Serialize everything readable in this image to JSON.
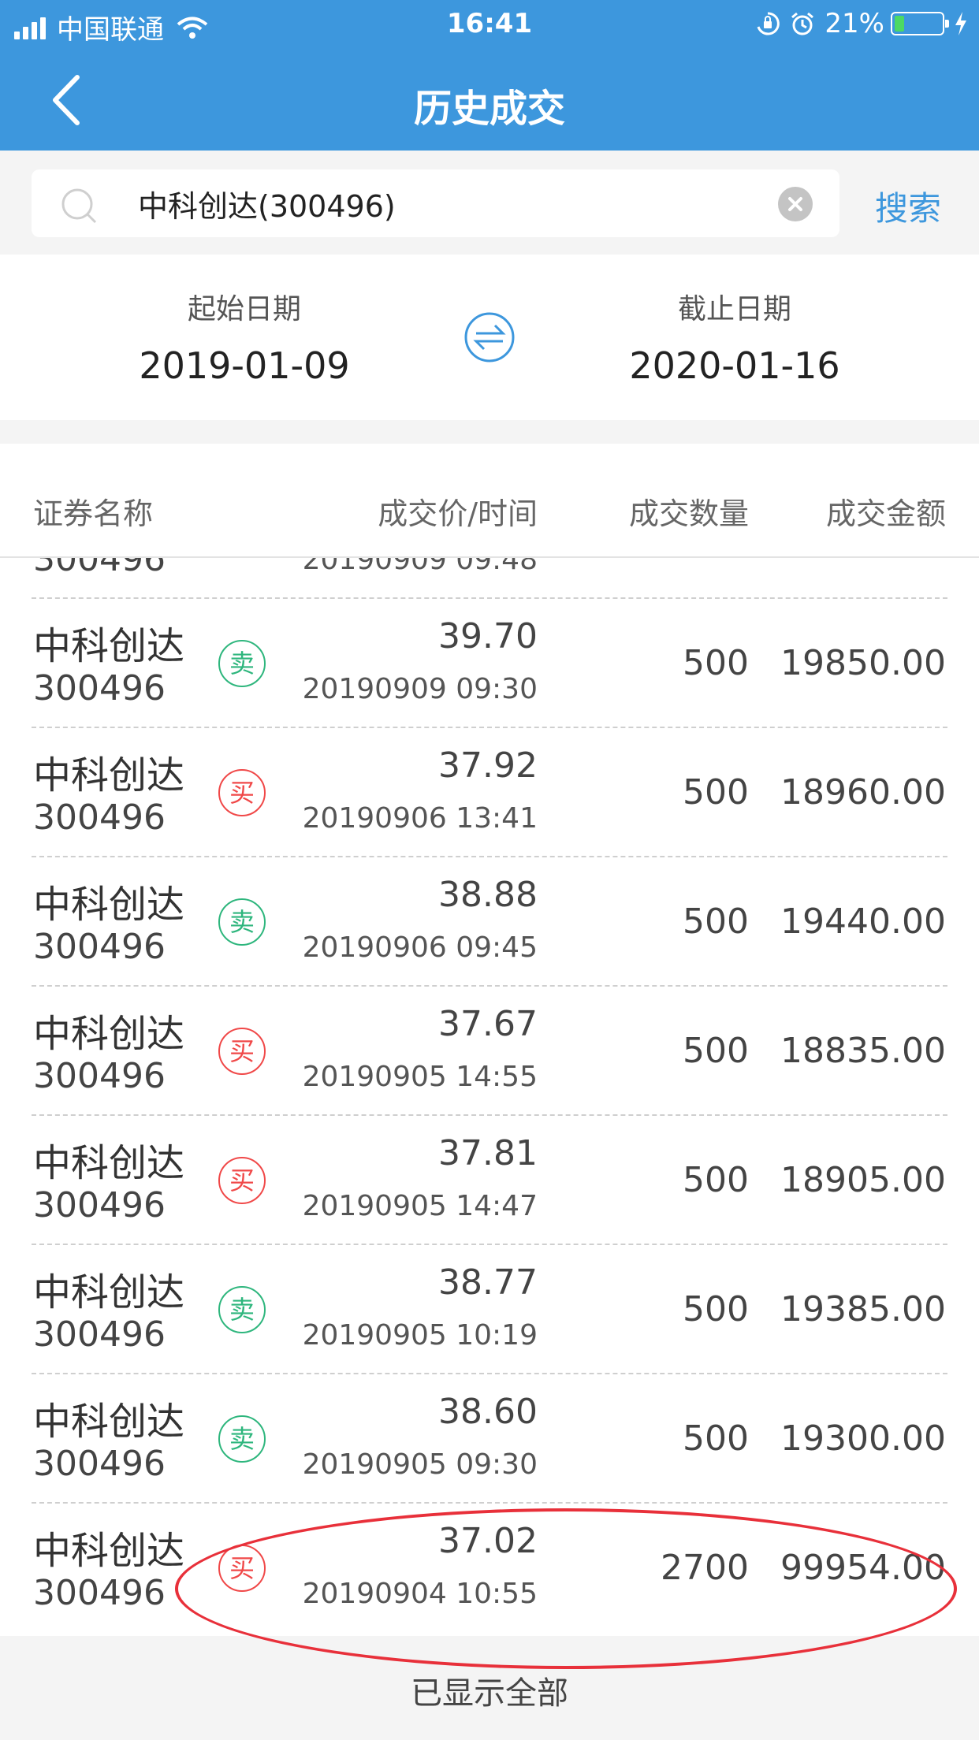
{
  "status_bar": {
    "carrier": "中国联通",
    "time": "16:41",
    "battery_percent": "21%",
    "battery_level": 0.21
  },
  "nav": {
    "title": "历史成交"
  },
  "search": {
    "value": "中科创达(300496)",
    "button_label": "搜索"
  },
  "dates": {
    "start_label": "起始日期",
    "start_value": "2019-01-09",
    "end_label": "截止日期",
    "end_value": "2020-01-16"
  },
  "table": {
    "headers": {
      "name": "证券名称",
      "price_time": "成交价/时间",
      "qty": "成交数量",
      "amount": "成交金额"
    },
    "partial_row": {
      "code": "300496",
      "time": "20190909 09:48"
    },
    "rows": [
      {
        "name": "中科创达",
        "code": "300496",
        "side": "卖",
        "type": "sell",
        "price": "39.70",
        "time": "20190909 09:30",
        "qty": "500",
        "amount": "19850.00"
      },
      {
        "name": "中科创达",
        "code": "300496",
        "side": "买",
        "type": "buy",
        "price": "37.92",
        "time": "20190906 13:41",
        "qty": "500",
        "amount": "18960.00"
      },
      {
        "name": "中科创达",
        "code": "300496",
        "side": "卖",
        "type": "sell",
        "price": "38.88",
        "time": "20190906 09:45",
        "qty": "500",
        "amount": "19440.00"
      },
      {
        "name": "中科创达",
        "code": "300496",
        "side": "买",
        "type": "buy",
        "price": "37.67",
        "time": "20190905 14:55",
        "qty": "500",
        "amount": "18835.00"
      },
      {
        "name": "中科创达",
        "code": "300496",
        "side": "买",
        "type": "buy",
        "price": "37.81",
        "time": "20190905 14:47",
        "qty": "500",
        "amount": "18905.00"
      },
      {
        "name": "中科创达",
        "code": "300496",
        "side": "卖",
        "type": "sell",
        "price": "38.77",
        "time": "20190905 10:19",
        "qty": "500",
        "amount": "19385.00"
      },
      {
        "name": "中科创达",
        "code": "300496",
        "side": "卖",
        "type": "sell",
        "price": "38.60",
        "time": "20190905 09:30",
        "qty": "500",
        "amount": "19300.00"
      },
      {
        "name": "中科创达",
        "code": "300496",
        "side": "买",
        "type": "buy",
        "price": "37.02",
        "time": "20190904 10:55",
        "qty": "2700",
        "amount": "99954.00"
      }
    ]
  },
  "footer": {
    "text": "已显示全部"
  },
  "colors": {
    "header_bg": "#3d97dd",
    "sell": "#2eb67d",
    "buy": "#f04848",
    "annotation": "#e8303a"
  },
  "icons": [
    "signal-icon",
    "wifi-icon",
    "orientation-lock-icon",
    "alarm-icon",
    "battery-icon",
    "charging-icon",
    "back-icon",
    "search-icon",
    "clear-icon",
    "swap-icon"
  ]
}
